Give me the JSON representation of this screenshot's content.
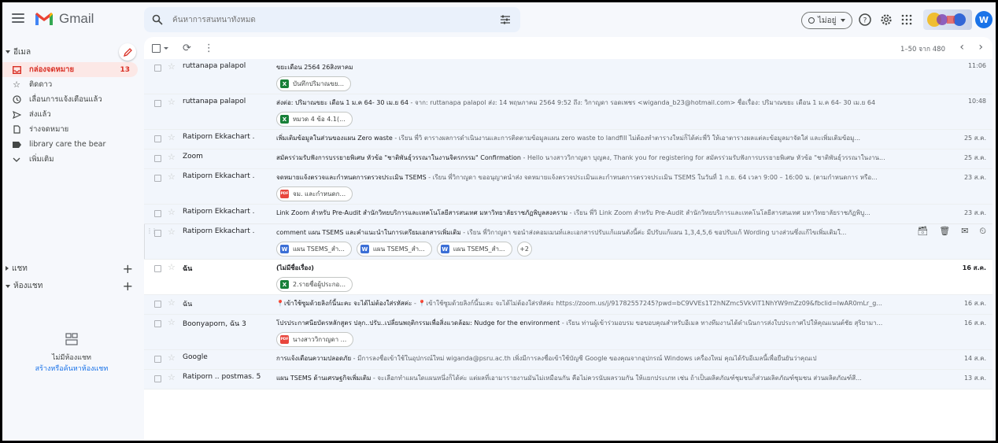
{
  "app": {
    "name": "Gmail"
  },
  "search": {
    "placeholder": "ค้นหาการสนทนาทั้งหมด"
  },
  "status": {
    "label": "ไม่อยู่"
  },
  "account": {
    "initial": "W"
  },
  "sidebar": {
    "mail_label": "อีเมล",
    "items": [
      {
        "label": "กล่องจดหมาย",
        "count": "13",
        "icon": "inbox-icon",
        "active": true
      },
      {
        "label": "ติดดาว",
        "count": "",
        "icon": "star-icon"
      },
      {
        "label": "เลื่อนการแจ้งเตือนแล้ว",
        "count": "",
        "icon": "clock-icon"
      },
      {
        "label": "ส่งแล้ว",
        "count": "",
        "icon": "send-icon"
      },
      {
        "label": "ร่างจดหมาย",
        "count": "",
        "icon": "draft-icon"
      },
      {
        "label": "library care the bear",
        "count": "",
        "icon": "label-icon"
      },
      {
        "label": "เพิ่มเติม",
        "count": "",
        "icon": "chevron-down-icon"
      }
    ],
    "chat_label": "แชท",
    "rooms_label": "ห้องแชท",
    "no_rooms": "ไม่มีห้องแชท",
    "find_rooms_link": "สร้างหรือค้นหาห้องแชท"
  },
  "toolbar": {
    "pager": "1–50 จาก 480"
  },
  "emails": [
    {
      "sender": "ruttanapa palapol",
      "subject": "ขยะเดือน 2564 26สิงหาคม",
      "snippet": "",
      "date": "11:06",
      "unread": false,
      "chips": [
        {
          "type": "X",
          "label": "บันทึกปริมาณขย..."
        }
      ]
    },
    {
      "sender": "ruttanapa palapol",
      "subject": "ส่งต่อ: ปริมาณขยะ เดือน 1 ม.ค 64- 30 เม.ย 64",
      "snippet": " - จาก: ruttanapa palapol ส่ง: 14 พฤษภาคม 2564 9:52 ถึง: วิกาญดา รอดเพชร <wiganda_b23@hotmail.com> ชื่อเรื่อง: ปริมาณขยะ เดือน 1 ม.ค 64- 30 เม.ย 64",
      "date": "10:48",
      "unread": false,
      "chips": [
        {
          "type": "X",
          "label": "หมวด 4 ข้อ 4.1(..."
        }
      ]
    },
    {
      "sender": "Ratiporn Ekkachart .",
      "subject": "เพิ่มเติมข้อมูลในส่วนของแผน Zero waste",
      "snippet": " - เรียน พี่วิ ตารางผลการดำเนินงานและการติดตามข้อมูลแผน zero waste to landfill ไม่ต้องทำตารางใหม่ก็ได้ค่ะพี่วิ ให้เอาตารางผลแต่ละข้อมูลมาจัดใส่ และเพิ่มเติมข้อมู...",
      "date": "25 ส.ค.",
      "unread": false,
      "chips": []
    },
    {
      "sender": "Zoom",
      "subject": "สมัครร่วมรับฟังการบรรยายพิเศษ หัวข้อ \"ชาติพันธุ์วรรณาในงานจิตรกรรม\" Confirmation",
      "snippet": " - Hello นางสาววิกาญดา บุญคง, Thank you for registering for สมัครร่วมรับฟังการบรรยายพิเศษ หัวข้อ \"ชาติพันธุ์วรรณาในงาน...",
      "date": "25 ส.ค.",
      "unread": false,
      "chips": []
    },
    {
      "sender": "Ratiporn Ekkachart .",
      "subject": "จดหมายแจ้งตรวจและกำหนดการตรวจประเมิน TSEMS",
      "snippet": " - เรียน พี่วิกาญดา ขออนุญาตนำส่ง จดหมายแจ้งตรวจประเมินและกำหนดการตรวจประเมิน TSEMS ในวันที่ 1 ก.ย. 64 เวลา 9:00 – 16:00 น. (ตามกำหนดการ หรือ...",
      "date": "23 ส.ค.",
      "unread": false,
      "chips": [
        {
          "type": "PDF",
          "label": "จม. และกำหนดก..."
        }
      ]
    },
    {
      "sender": "Ratiporn Ekkachart .",
      "subject": "Link Zoom สำหรับ Pre-Audit สำนักวิทยบริการและเทคโนโลยีสารสนเทศ มหาวิทยาลัยราชภัฏพิบูลสงคราม",
      "snippet": " - เรียน พี่วิ Link Zoom สำหรับ Pre-Audit สำนักวิทยบริการและเทคโนโลยีสารสนเทศ มหาวิทยาลัยราชภัฏพิบู...",
      "date": "23 ส.ค.",
      "unread": false,
      "chips": []
    },
    {
      "sender": "Ratiporn Ekkachart .",
      "subject": "comment แผน TSEMS และคำแนะนำในการเตรียมเอกสารเพิ่มเติม",
      "snippet": " - เรียน พี่วิกาญดา ขอนำส่งคอมเมนท์และเอกสารปรับแก้แผนตังนี้ค่ะ มีปรับแก้แผน 1,3,4,5,6 ขอปรับแก้ Wording บางส่วนซึ่งแก้ไขเพิ่มเติมใ...",
      "date": "",
      "unread": false,
      "hover": true,
      "chips": [
        {
          "type": "W",
          "label": "แผน TSEMS_สำ..."
        },
        {
          "type": "W",
          "label": "แผน TSEMS_สำ..."
        },
        {
          "type": "W",
          "label": "แผน TSEMS_สำ..."
        },
        {
          "type": "more",
          "label": "+2"
        }
      ]
    },
    {
      "sender": "ฉัน",
      "subject": "(ไม่มีชื่อเรื่อง)",
      "snippet": "",
      "date": "16 ส.ค.",
      "unread": true,
      "chips": [
        {
          "type": "X",
          "label": "2.รายชื่อผู้ประกอ..."
        }
      ]
    },
    {
      "sender": "ฉัน",
      "subject": "📍เข้าใช้ซูมด้วยลิงก์นี้นะคะ จะได้ไม่ต้องใส่รหัสค่ะ",
      "snippet": " - 📍เข้าใช้ซูมด้วยลิงก์นี้นะคะ จะได้ไม่ต้องใส่รหัสค่ะ https://zoom.us/j/91782557245?pwd=bC9VVEs1T2hNZmc5VkViT1NhYW9mZz09&fbclid=IwAR0mLr_g...",
      "date": "16 ส.ค.",
      "unread": false,
      "chips": []
    },
    {
      "sender": "Boonyaporn, ฉัน 3",
      "subject": "โปรประกาศนียบัตรหลักสูตร ปลุก..ปรับ..เปลี่ยนพฤติกรรมเพื่อสิ่งแวดล้อม: Nudge for the environment",
      "snippet": " - เรียน ท่านผู้เข้าร่วมอบรม ขอขอบคุณสำหรับอีเมล ทางทีมงานได้ดำเนินการส่งใบประกาศไปให้คุณแนนต์ชัย สุริยามา...",
      "date": "16 ส.ค.",
      "unread": false,
      "chips": [
        {
          "type": "PDF",
          "label": "นางสาววิกาญดา ..."
        }
      ]
    },
    {
      "sender": "Google",
      "subject": "การแจ้งเตือนความปลอดภัย",
      "snippet": " - มีการลงชื่อเข้าใช้ในอุปกรณ์ใหม่ wiganda@psru.ac.th เพิ่งมีการลงชื่อเข้าใช้บัญชี Google ของคุณจากอุปกรณ์ Windows เครื่องใหม่ คุณได้รับอีเมลนี้เพื่อยืนยันว่าคุณเป",
      "date": "14 ส.ค.",
      "unread": false,
      "chips": []
    },
    {
      "sender": "Ratiporn .. postmas. 5",
      "subject": "แผน TSEMS ด้านเศรษฐกิจเพิ่มเติม",
      "snippet": " - จะเลือกทำแผนใดแผนหนึ่งก็ได้ค่ะ แต่ผลที่เอามารายงานมันไม่เหมือนกัน คือไม่ควรนับผลรวมกัน ให้แยกประเภท เช่น ถ้าเป็นผลิตภัณฑ์ชุมชนก็ส่วนผลิตภัณฑ์ชุมชน ส่วนผลิตภัณฑ์สี...",
      "date": "13 ส.ค.",
      "unread": false,
      "chips": []
    }
  ],
  "colors": {
    "inbox_active_bg": "#fce8e6",
    "inbox_active_fg": "#d93025",
    "excel": "#188038",
    "word": "#3b6fd6",
    "pdf": "#e8453c",
    "link": "#1a73e8"
  }
}
